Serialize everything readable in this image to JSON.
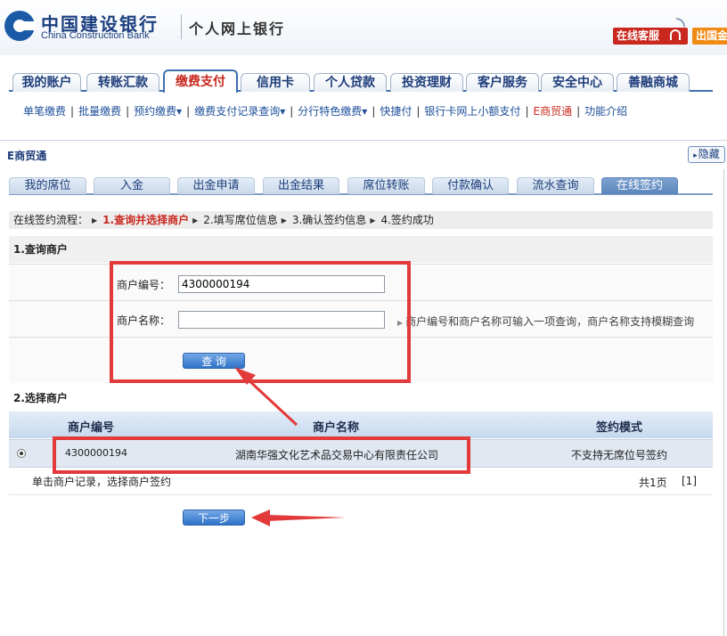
{
  "header": {
    "bank_name_cn": "中国建设银行",
    "bank_name_en": "China Construction Bank",
    "site_name": "个人网上银行",
    "online_service": "在线客服",
    "overseas_label": "出国金"
  },
  "nav": {
    "tabs": [
      "我的账户",
      "转账汇款",
      "缴费支付",
      "信用卡",
      "个人贷款",
      "投资理财",
      "客户服务",
      "安全中心",
      "善融商城"
    ],
    "active": "缴费支付"
  },
  "subnav": {
    "items": [
      "单笔缴费",
      "批量缴费",
      "预约缴费▾",
      "缴费支付记录查询▾",
      "分行特色缴费▾",
      "快捷付",
      "银行卡网上小额支付",
      "E商贸通",
      "功能介绍"
    ],
    "current": "E商贸通"
  },
  "section": {
    "title": "E商贸通",
    "hide_label": "隐藏"
  },
  "subtabs": {
    "items": [
      "我的席位",
      "入金",
      "出金申请",
      "出金结果",
      "席位转账",
      "付款确认",
      "流水查询",
      "在线签约"
    ],
    "active": "在线签约"
  },
  "flow": {
    "prefix": "在线签约流程：",
    "steps": [
      "1.查询并选择商户",
      "2.填写席位信息",
      "3.确认签约信息",
      "4.签约成功"
    ]
  },
  "query": {
    "title": "1.查询商户",
    "merchant_no_label": "商户编号：",
    "merchant_no_value": "4300000194",
    "merchant_name_label": "商户名称：",
    "merchant_name_value": "",
    "hint": "商户编号和商户名称可输入一项查询，商户名称支持模糊查询",
    "button": "查 询"
  },
  "select": {
    "title": "2.选择商户",
    "columns": [
      "商户编号",
      "商户名称",
      "签约模式"
    ],
    "rows": [
      {
        "merchant_no": "4300000194",
        "merchant_name": "湖南华强文化艺术品交易中心有限责任公司",
        "mode": "不支持无席位号签约",
        "selected": true
      }
    ],
    "footer_hint": "单击商户记录，选择商户签约",
    "page_total": "共1页",
    "page_nav": "[1]"
  },
  "next_button": "下一步",
  "colors": {
    "brand_blue": "#1b5aa6",
    "highlight_red": "#c8281e",
    "annotation_red": "#e23a3a"
  }
}
